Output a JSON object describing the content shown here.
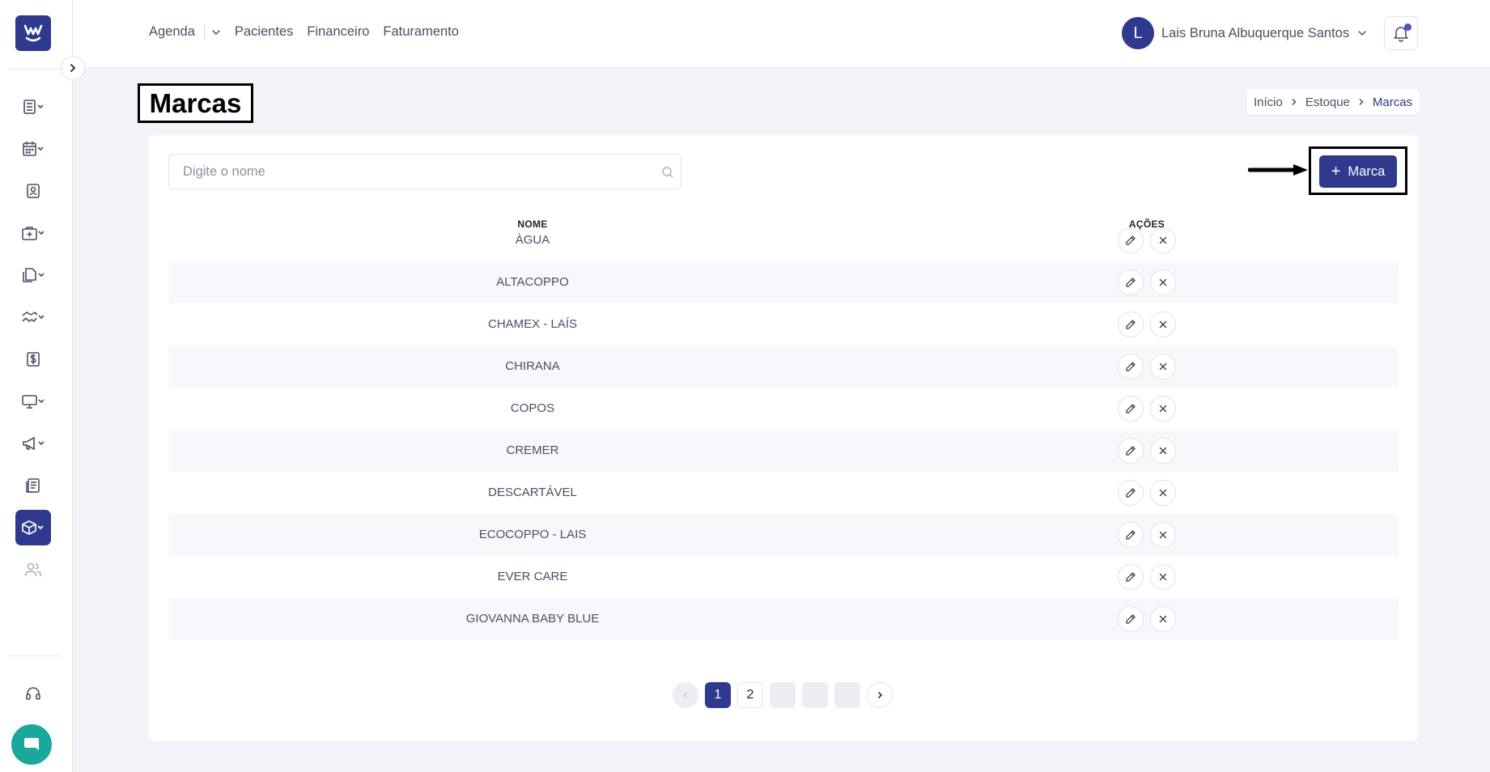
{
  "topnav": {
    "items": [
      "Agenda",
      "Pacientes",
      "Financeiro",
      "Faturamento"
    ]
  },
  "user": {
    "initial": "L",
    "name": "Lais Bruna Albuquerque Santos"
  },
  "page": {
    "title": "Marcas"
  },
  "breadcrumb": [
    "Início",
    "Estoque",
    "Marcas"
  ],
  "search": {
    "placeholder": "Digite o nome",
    "value": ""
  },
  "add_button": {
    "label": "Marca"
  },
  "table": {
    "columns": [
      "NOME",
      "AÇÕES"
    ],
    "rows": [
      "ÀGUA",
      "ALTACOPPO",
      "CHAMEX - LAÍS",
      "CHIRANA",
      "COPOS",
      "CREMER",
      "DESCARTÁVEL",
      "ECOCOPPO - LAIS",
      "EVER CARE",
      "GIOVANNA BABY BLUE"
    ]
  },
  "pagination": {
    "pages": [
      "1",
      "2",
      "",
      "",
      ""
    ],
    "current": "1"
  },
  "colors": {
    "primary": "#2f3a8f",
    "chat": "#1aa89b",
    "background": "#f3f4fa"
  },
  "sidebar": {
    "icons": [
      "menu-list-icon",
      "calendar-icon",
      "patient-card-icon",
      "medical-kit-icon",
      "documents-icon",
      "handshake-icon",
      "dollar-icon",
      "monitor-icon",
      "megaphone-icon",
      "report-icon",
      "box-icon",
      "users-icon",
      "headset-icon",
      "chat-icon"
    ]
  }
}
